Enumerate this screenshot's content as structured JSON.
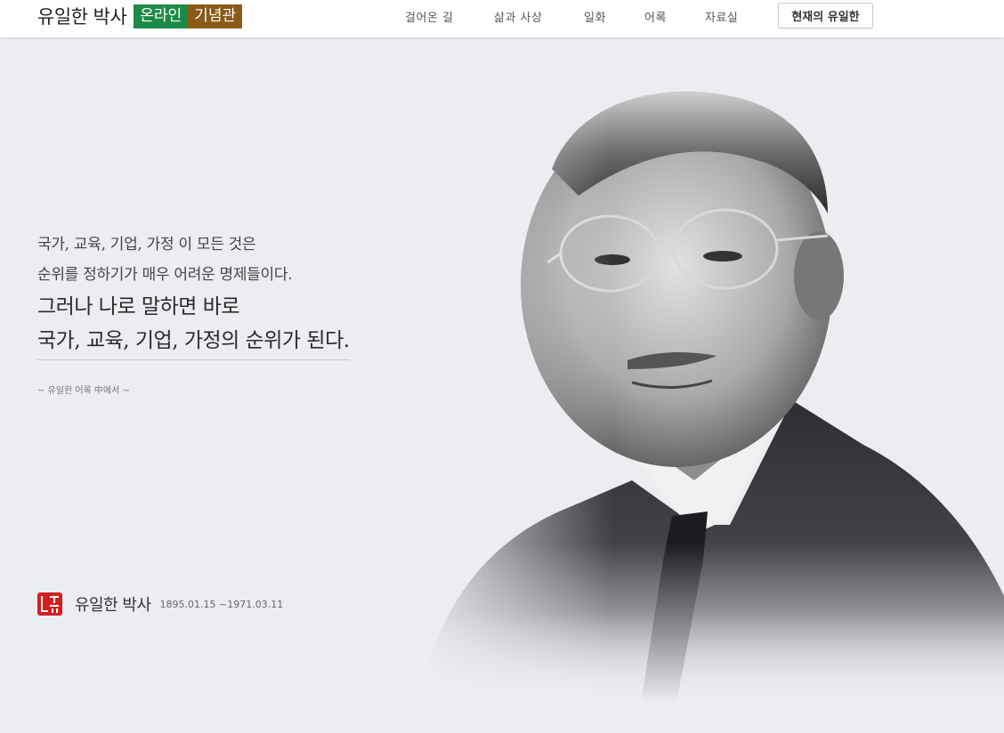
{
  "header": {
    "logo_name": "유일한 박사",
    "logo_tag_online": "온라인",
    "logo_tag_museum": "기념관",
    "nav": [
      "걸어온 길",
      "삶과 사상",
      "일화",
      "어록",
      "자료실"
    ],
    "cta_button": "현재의 유일한"
  },
  "quote": {
    "line1": "국가, 교육, 기업, 가정 이 모든 것은",
    "line2": "순위를 정하기가 매우 어려운 명제들이다.",
    "line3": "그러나 나로 말하면 바로",
    "line4": "국가, 교육, 기업, 가정의 순위가 된다.",
    "source": "~ 유일한 어록 中에서 ~"
  },
  "signature": {
    "name": "유일한 박사",
    "dates": "1895.01.15 ~1971.03.11"
  },
  "colors": {
    "background": "#ecedf1",
    "online_tag": "#1e8a47",
    "museum_tag": "#8a5a16",
    "seal": "#d21f1f"
  },
  "icons": {
    "seal": "seal-icon"
  }
}
